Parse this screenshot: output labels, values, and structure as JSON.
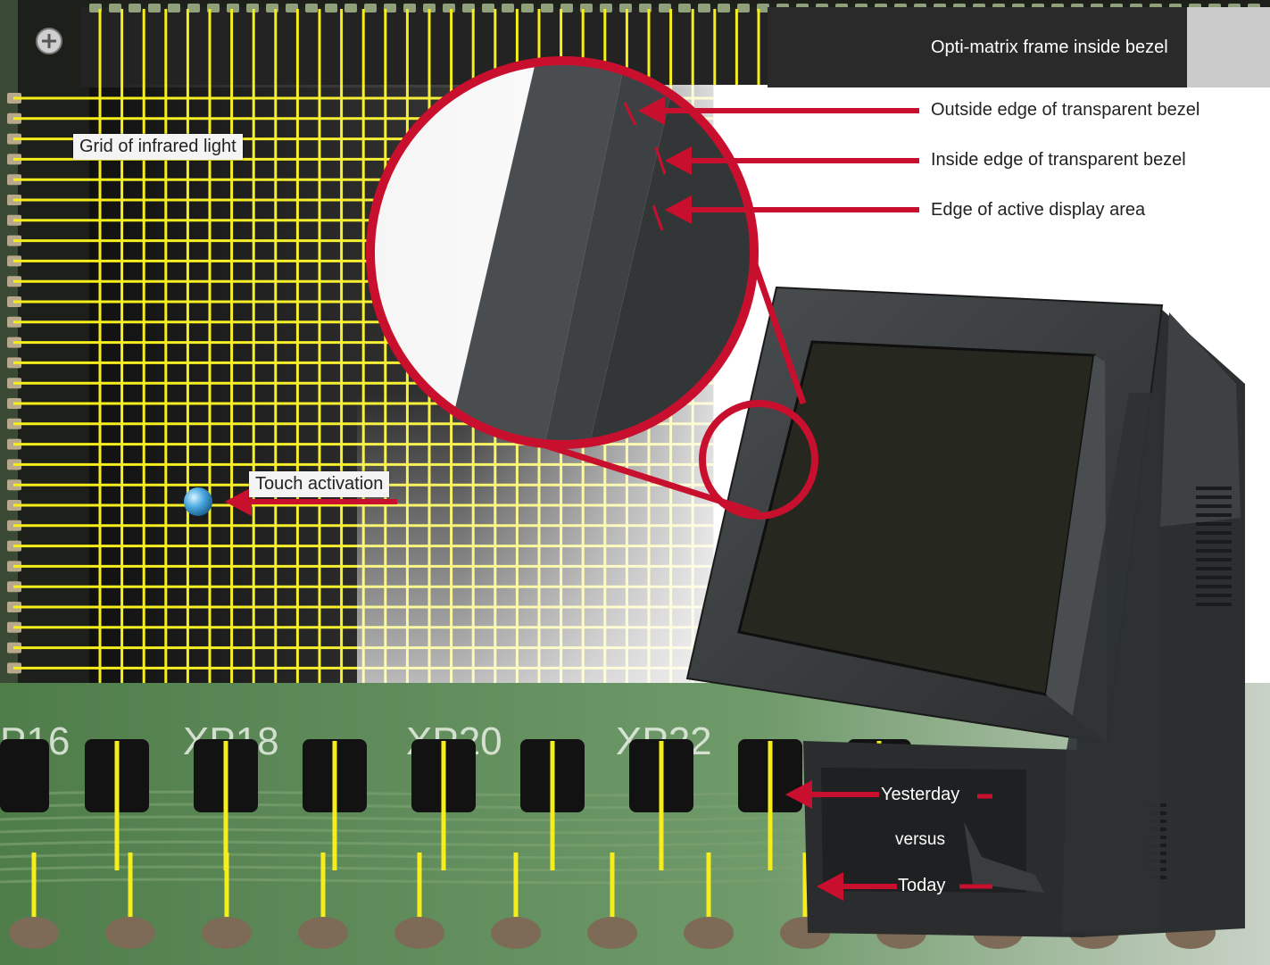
{
  "colors": {
    "grid_line": "#f6ee1a",
    "arrow": "#c8102e",
    "pcb_green": "#5e8a55",
    "frame_black": "#151515",
    "monitor_gray": "#3a3d3e",
    "screen": "#2b2c26"
  },
  "labels": {
    "frame": "Opti-matrix frame inside bezel",
    "outside_edge": "Outside edge of transparent bezel",
    "inside_edge": "Inside edge of transparent bezel",
    "active_area": "Edge of active display area",
    "grid": "Grid of infrared light",
    "touch": "Touch activation",
    "yesterday": "Yesterday",
    "versus": "versus",
    "today": "Today"
  },
  "pcb_markings": [
    "P16",
    "XP18",
    "XP20",
    "XP22"
  ],
  "icons": {
    "screw": "screw-icon",
    "touch_point": "touch-point-icon"
  }
}
